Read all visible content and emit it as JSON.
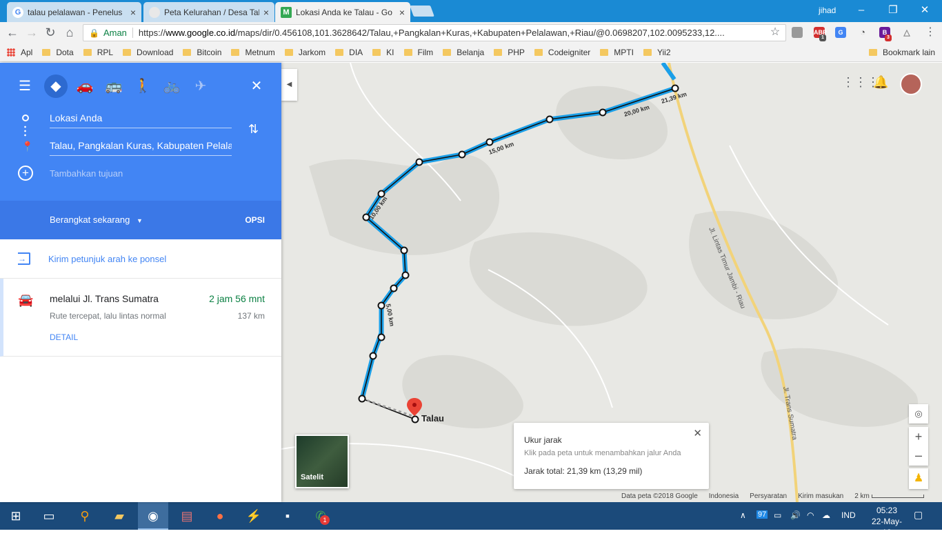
{
  "browser": {
    "tabs": [
      {
        "title": "talau pelalawan - Penelus",
        "favicon": "G"
      },
      {
        "title": "Peta Kelurahan / Desa Tal",
        "favicon": ""
      },
      {
        "title": "Lokasi Anda ke Talau - Go",
        "favicon": "M"
      }
    ],
    "user": "jihad",
    "secure_label": "Aman",
    "url_scheme": "https://",
    "url_domain": "www.google.co.id",
    "url_path": "/maps/dir/0.456108,101.3628642/Talau,+Pangkalan+Kuras,+Kabupaten+Pelalawan,+Riau/@0.0698207,102.0095233,12....",
    "extension_badges": [
      "1",
      "3"
    ],
    "bookmarks": [
      "Apl",
      "Dota",
      "RPL",
      "Download",
      "Bitcoin",
      "Metnum",
      "Jarkom",
      "DIA",
      "KI",
      "Film",
      "Belanja",
      "PHP",
      "Codeigniter",
      "MPTI",
      "Yii2"
    ],
    "bookmarks_right": "Bookmark lain"
  },
  "directions": {
    "origin": "Lokasi Anda",
    "destination": "Talau, Pangkalan Kuras, Kabupaten Pelalawan, Riau",
    "add_destination": "Tambahkan tujuan",
    "depart": "Berangkat sekarang",
    "options": "OPSI",
    "send_to_phone": "Kirim petunjuk arah ke ponsel",
    "route": {
      "via": "melalui Jl. Trans Sumatra",
      "duration": "2 jam 56 mnt",
      "summary": "Rute tercepat, lalu lintas normal",
      "distance": "137 km",
      "detail": "DETAIL"
    }
  },
  "map": {
    "place_label": "Talau",
    "road_labels": [
      "Jl. Lintas Timur Jambi - Riau",
      "Jl. Trans Sumatra"
    ],
    "distance_labels": [
      "5,00 km",
      "10,00 km",
      "15,00 km",
      "20,00 km",
      "21,39 km"
    ],
    "satellite_label": "Satelit",
    "measure": {
      "title": "Ukur jarak",
      "hint": "Klik pada peta untuk menambahkan jalur Anda",
      "total": "Jarak total: 21,39 km (13,29 mil)"
    },
    "footer": [
      "Data peta ©2018 Google",
      "Indonesia",
      "Persyaratan",
      "Kirim masukan"
    ],
    "scale": "2 km",
    "route_color": "#1a9fe8"
  },
  "taskbar": {
    "notification_count": "1",
    "battery": "97",
    "language": "IND",
    "time": "05:23",
    "date": "22-May-18"
  }
}
